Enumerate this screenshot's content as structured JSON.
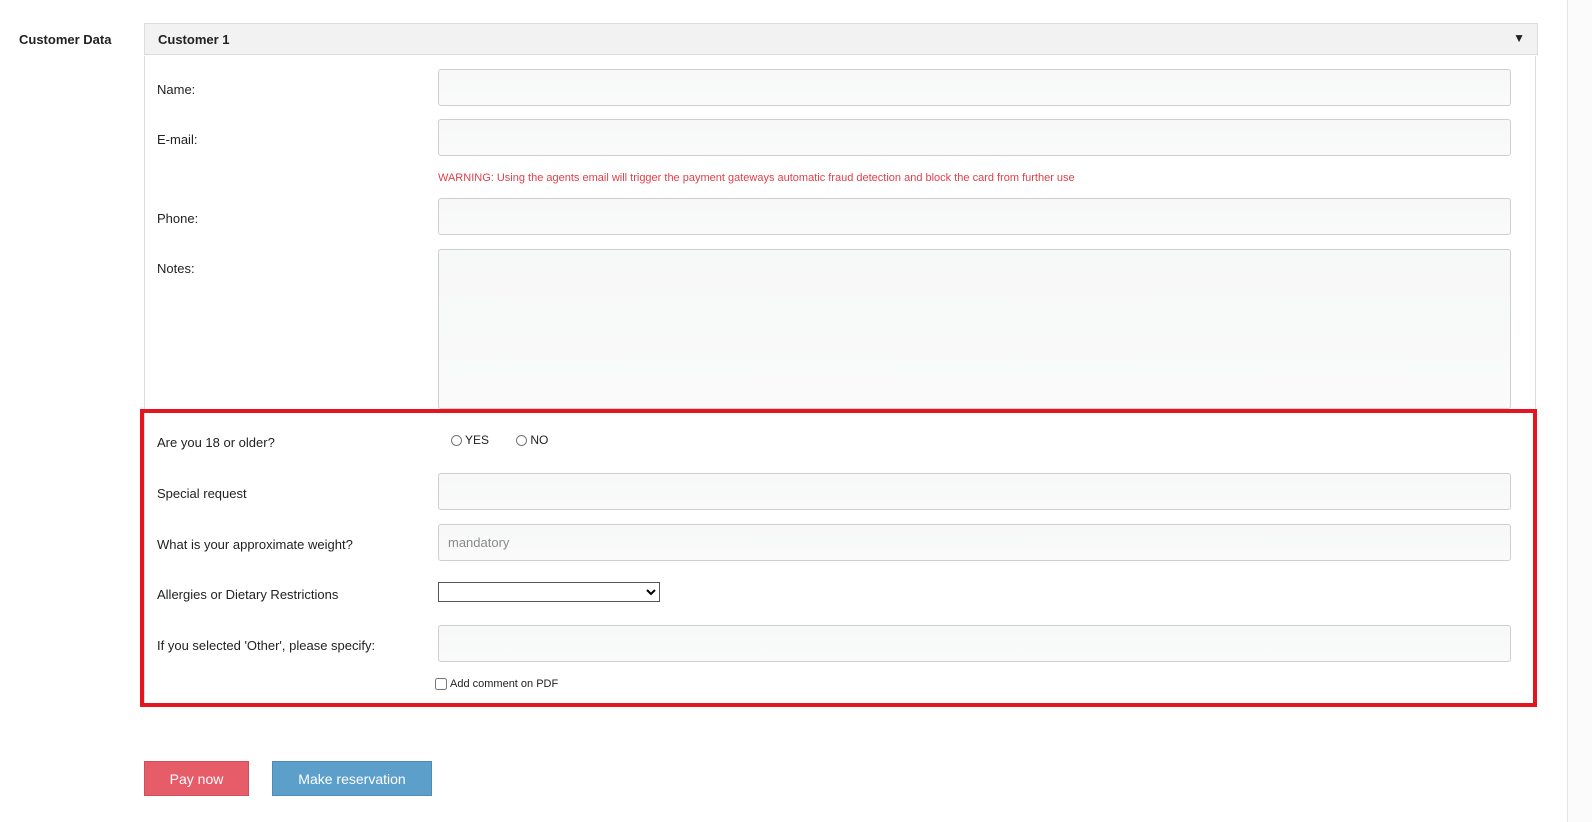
{
  "section": {
    "label": "Customer Data"
  },
  "panel": {
    "title": "Customer 1",
    "toggle_icon": "▼"
  },
  "fields": {
    "name": {
      "label": "Name:",
      "value": "",
      "placeholder": ""
    },
    "email": {
      "label": "E-mail:",
      "value": "",
      "placeholder": ""
    },
    "email_warning": "WARNING: Using the agents email will trigger the payment gateways automatic fraud detection and block the card from further use",
    "phone": {
      "label": "Phone:",
      "value": "",
      "placeholder": ""
    },
    "notes": {
      "label": "Notes:",
      "value": "",
      "placeholder": ""
    },
    "age_check": {
      "label": "Are you 18 or older?",
      "options": [
        "YES",
        "NO"
      ]
    },
    "special_request": {
      "label": "Special request",
      "value": "",
      "placeholder": ""
    },
    "weight": {
      "label": "What is your approximate weight?",
      "value": "",
      "placeholder": "mandatory"
    },
    "allergies": {
      "label": "Allergies or Dietary Restrictions",
      "selected": ""
    },
    "other_specify": {
      "label": "If you selected 'Other', please specify:",
      "value": "",
      "placeholder": ""
    },
    "add_comment": {
      "label": "Add comment on PDF"
    }
  },
  "buttons": {
    "pay_now": "Pay now",
    "make_reservation": "Make reservation"
  },
  "colors": {
    "highlight": "#e3161f",
    "warning": "#e0404a",
    "pay_button": "#e75c69",
    "reserve_button": "#5c9fcb"
  }
}
